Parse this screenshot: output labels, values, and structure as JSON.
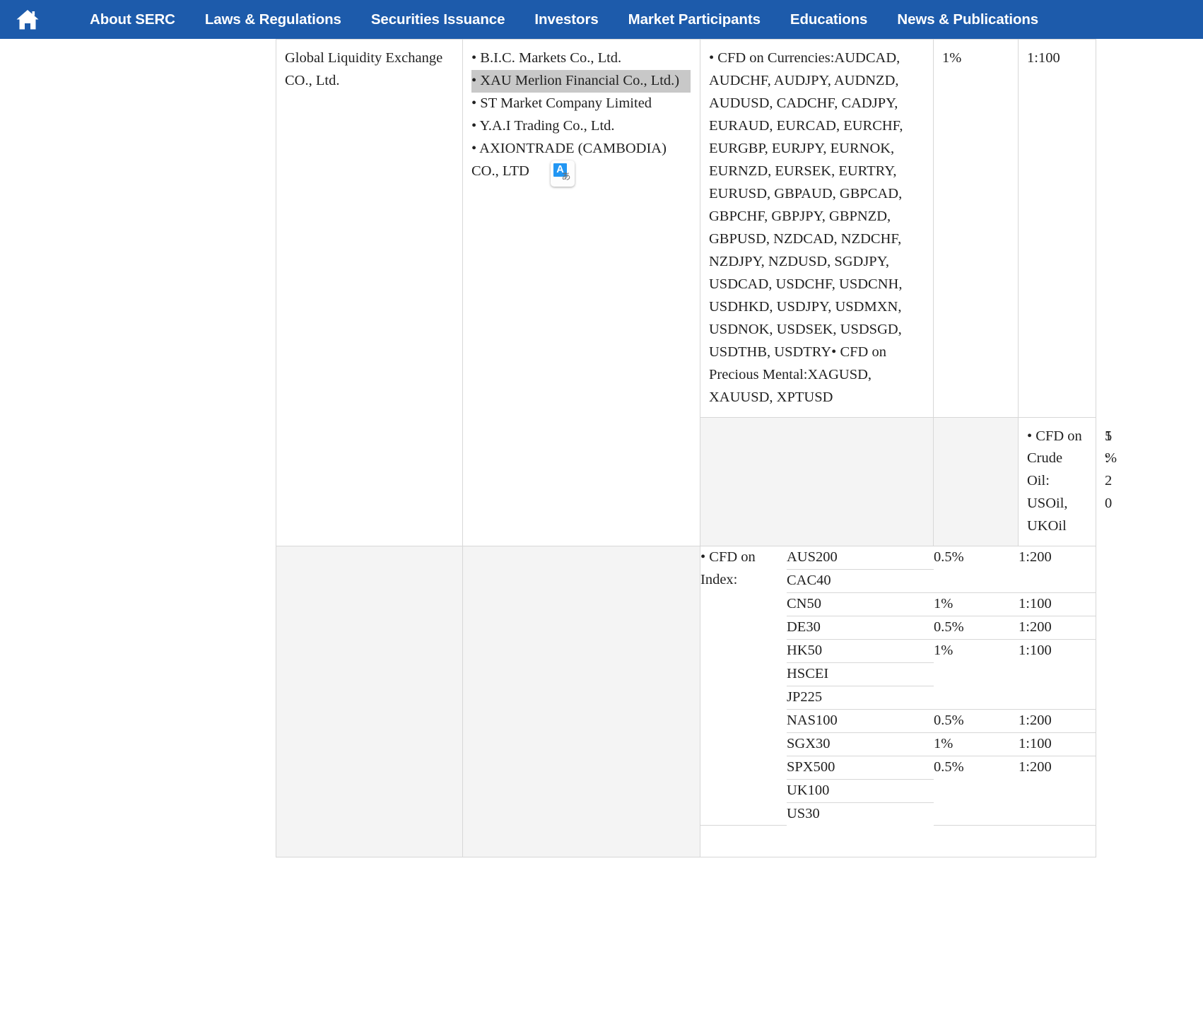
{
  "nav": {
    "home_icon": "home-icon",
    "items": [
      "About SERC",
      "Laws & Regulations",
      "Securities Issuance",
      "Investors",
      "Market Participants",
      "Educations",
      "News & Publications"
    ],
    "background_color": "#1d5bab",
    "text_color": "#ffffff"
  },
  "ime_indicator": {
    "latin_badge": "A",
    "kana_glyph": "あ"
  },
  "table": {
    "selection_highlight_color": "#c8c8c8",
    "shaded_row_color": "#f4f4f4",
    "rows": [
      {
        "company": "Global Liquidity Exchange CO., Ltd.",
        "subsidiaries": [
          "• B.I.C. Markets Co., Ltd.",
          "• XAU Merlion Financial Co., Ltd.)",
          "• ST Market Company Limited",
          "• Y.A.I Trading Co., Ltd.",
          "• AXIONTRADE (CAMBODIA) CO., LTD"
        ],
        "subsidiary_highlighted_index": 1,
        "products": "• CFD on Currencies:AUDCAD, AUDCHF, AUDJPY, AUDNZD, AUDUSD, CADCHF, CADJPY, EURAUD, EURCAD, EURCHF, EURGBP, EURJPY, EURNOK, EURNZD, EURSEK, EURTRY, EURUSD, GBPAUD, GBPCAD, GBPCHF, GBPJPY, GBPNZD, GBPUSD, NZDCAD, NZDCHF, NZDJPY, NZDUSD, SGDJPY, USDCAD, USDCHF, USDCNH, USDHKD, USDJPY, USDMXN, USDNOK, USDSEK, USDSGD, USDTHB, USDTRY• CFD on Precious Mental:XAGUSD, XAUUSD, XPTUSD",
        "margin": "1%",
        "leverage": "1:100"
      },
      {
        "company": "",
        "subsidiaries": [],
        "products": "• CFD on Crude Oil: USOil, UKOil",
        "margin": "5%",
        "leverage": "1:20"
      }
    ],
    "index_section": {
      "label": "• CFD on Index:",
      "entries": [
        {
          "name": "AUS200",
          "margin": "0.5%",
          "leverage": "1:200"
        },
        {
          "name": "CAC40",
          "margin": "",
          "leverage": ""
        },
        {
          "name": "CN50",
          "margin": "1%",
          "leverage": "1:100"
        },
        {
          "name": "DE30",
          "margin": "0.5%",
          "leverage": "1:200"
        },
        {
          "name": "HK50",
          "margin": "1%",
          "leverage": "1:100"
        },
        {
          "name": "HSCEI",
          "margin": "",
          "leverage": ""
        },
        {
          "name": "JP225",
          "margin": "",
          "leverage": ""
        },
        {
          "name": "NAS100",
          "margin": "0.5%",
          "leverage": "1:200"
        },
        {
          "name": "SGX30",
          "margin": "1%",
          "leverage": "1:100"
        },
        {
          "name": "SPX500",
          "margin": "0.5%",
          "leverage": "1:200"
        },
        {
          "name": "UK100",
          "margin": "",
          "leverage": ""
        },
        {
          "name": "US30",
          "margin": "",
          "leverage": ""
        }
      ]
    }
  }
}
